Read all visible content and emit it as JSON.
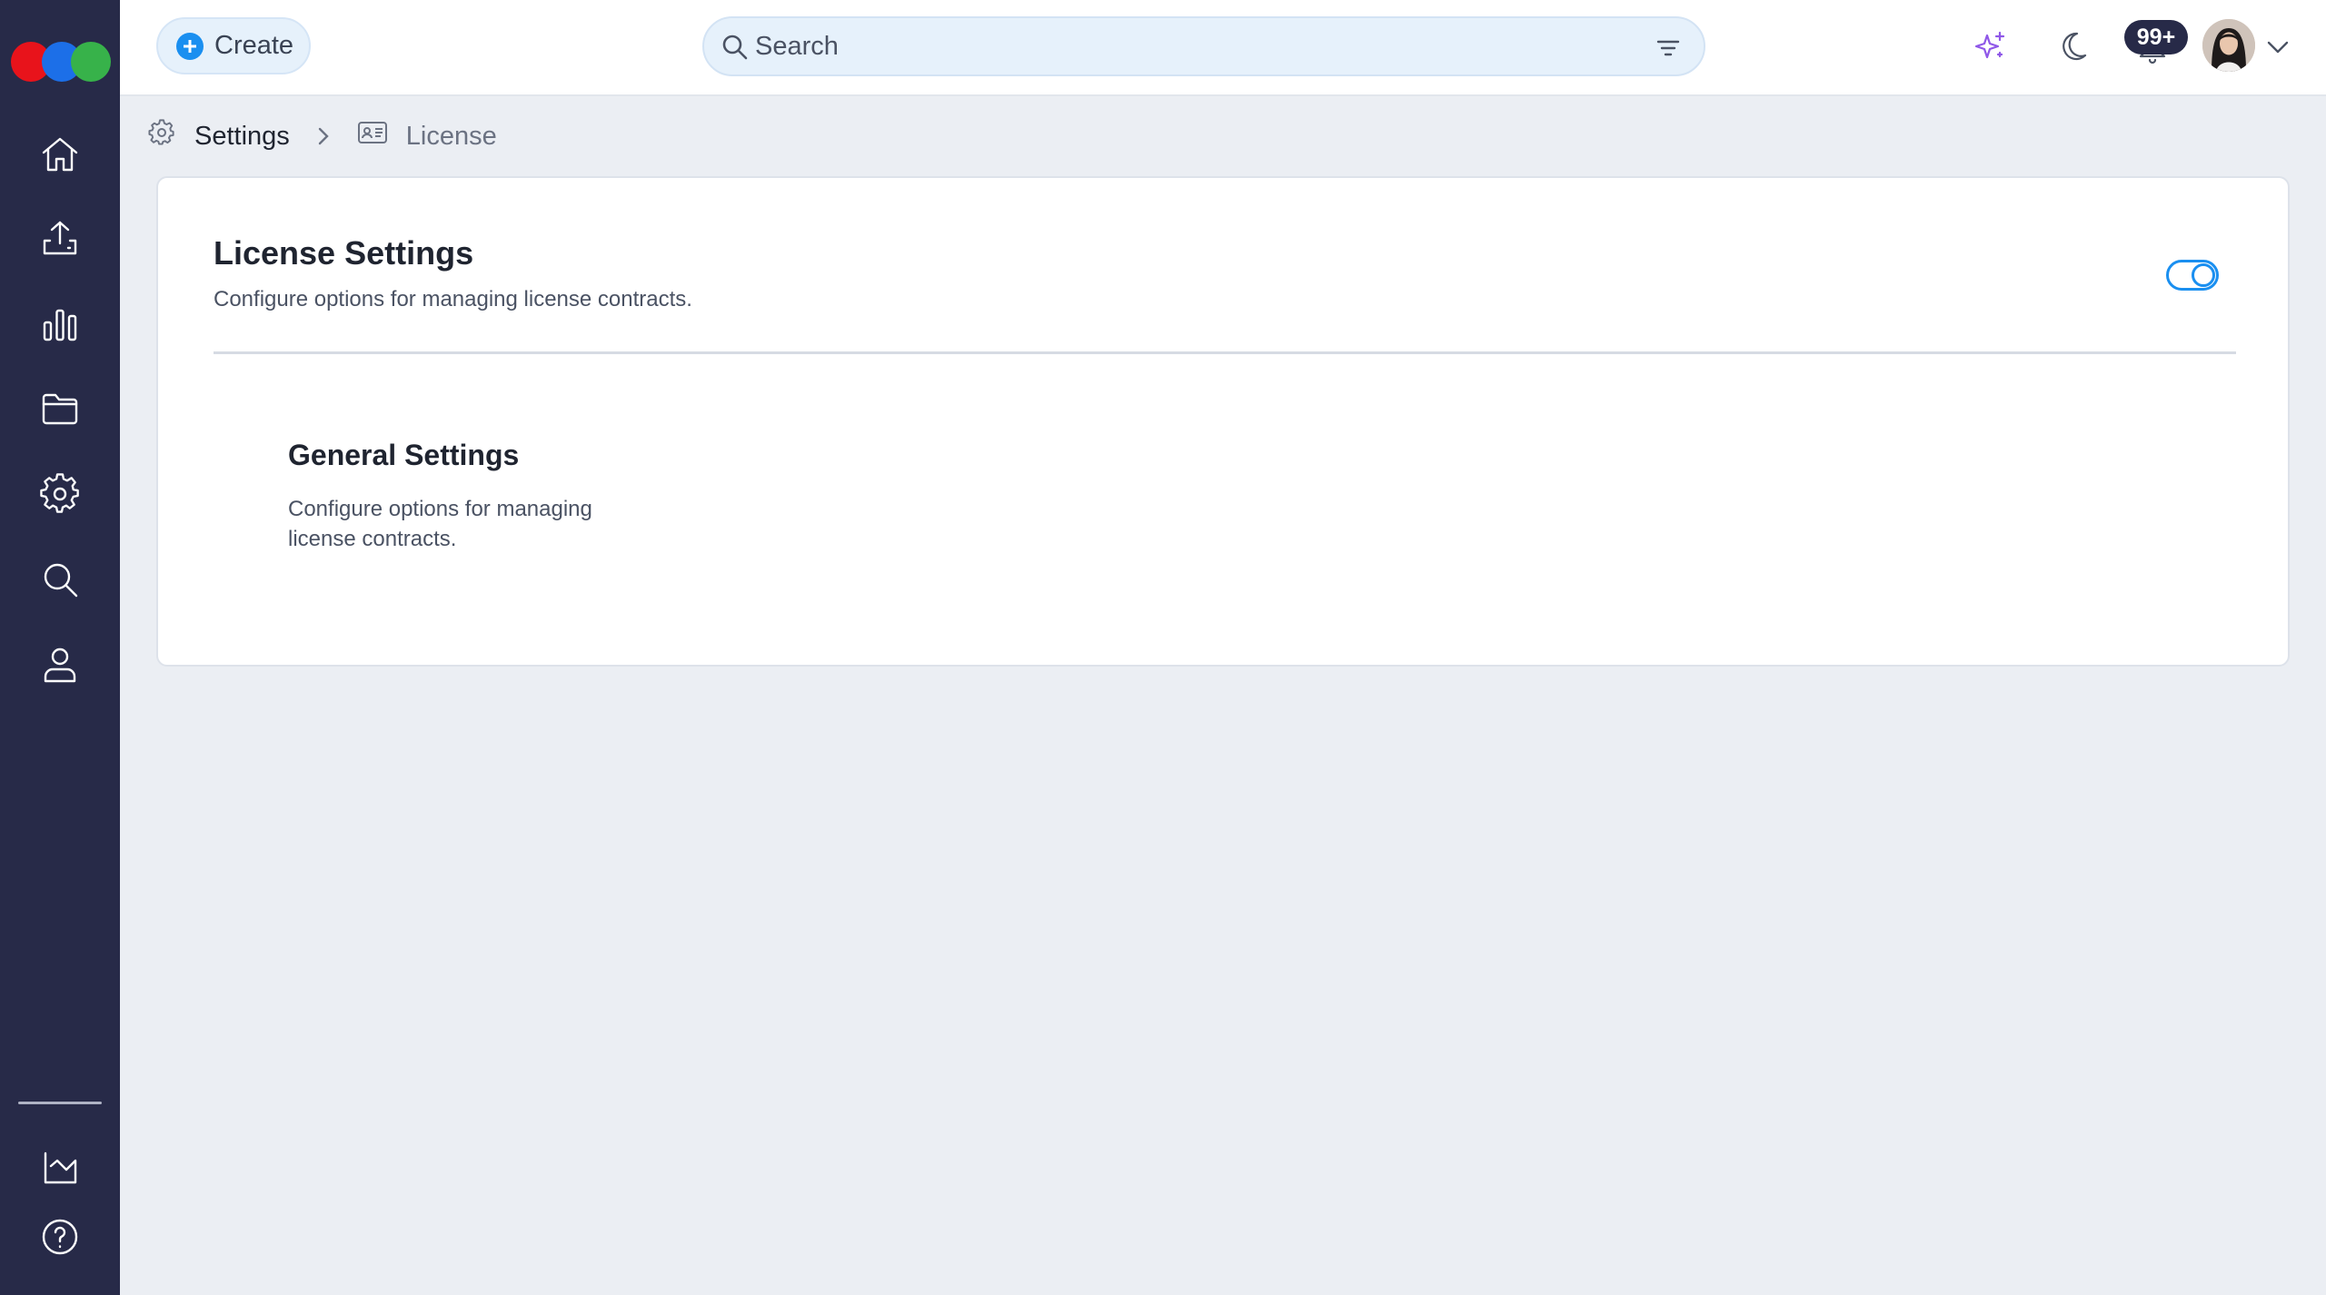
{
  "header": {
    "create_label": "Create",
    "search_placeholder": "Search",
    "notification_count": "99+"
  },
  "breadcrumb": {
    "items": [
      {
        "label": "Settings",
        "icon": "gear-icon"
      },
      {
        "label": "License",
        "icon": "id-card-icon"
      }
    ]
  },
  "sidebar": {
    "items": [
      {
        "name": "home",
        "icon": "home-icon"
      },
      {
        "name": "upload",
        "icon": "upload-icon"
      },
      {
        "name": "analytics",
        "icon": "bar-chart-icon"
      },
      {
        "name": "files",
        "icon": "folder-icon"
      },
      {
        "name": "settings",
        "icon": "gear-icon"
      },
      {
        "name": "search",
        "icon": "search-icon"
      },
      {
        "name": "profile",
        "icon": "user-icon"
      },
      {
        "name": "reports",
        "icon": "factory-chart-icon"
      },
      {
        "name": "help",
        "icon": "help-icon"
      }
    ]
  },
  "main": {
    "card_title": "License Settings",
    "card_subtitle": "Configure options for managing license contracts.",
    "toggle_on": true,
    "section": {
      "title": "General Settings",
      "description": "Configure options for managing license contracts."
    }
  },
  "colors": {
    "sidebar_bg": "#272a48",
    "accent": "#1a8ff0",
    "page_bg": "#ebeef3",
    "ai_accent": "#8f57e8"
  }
}
